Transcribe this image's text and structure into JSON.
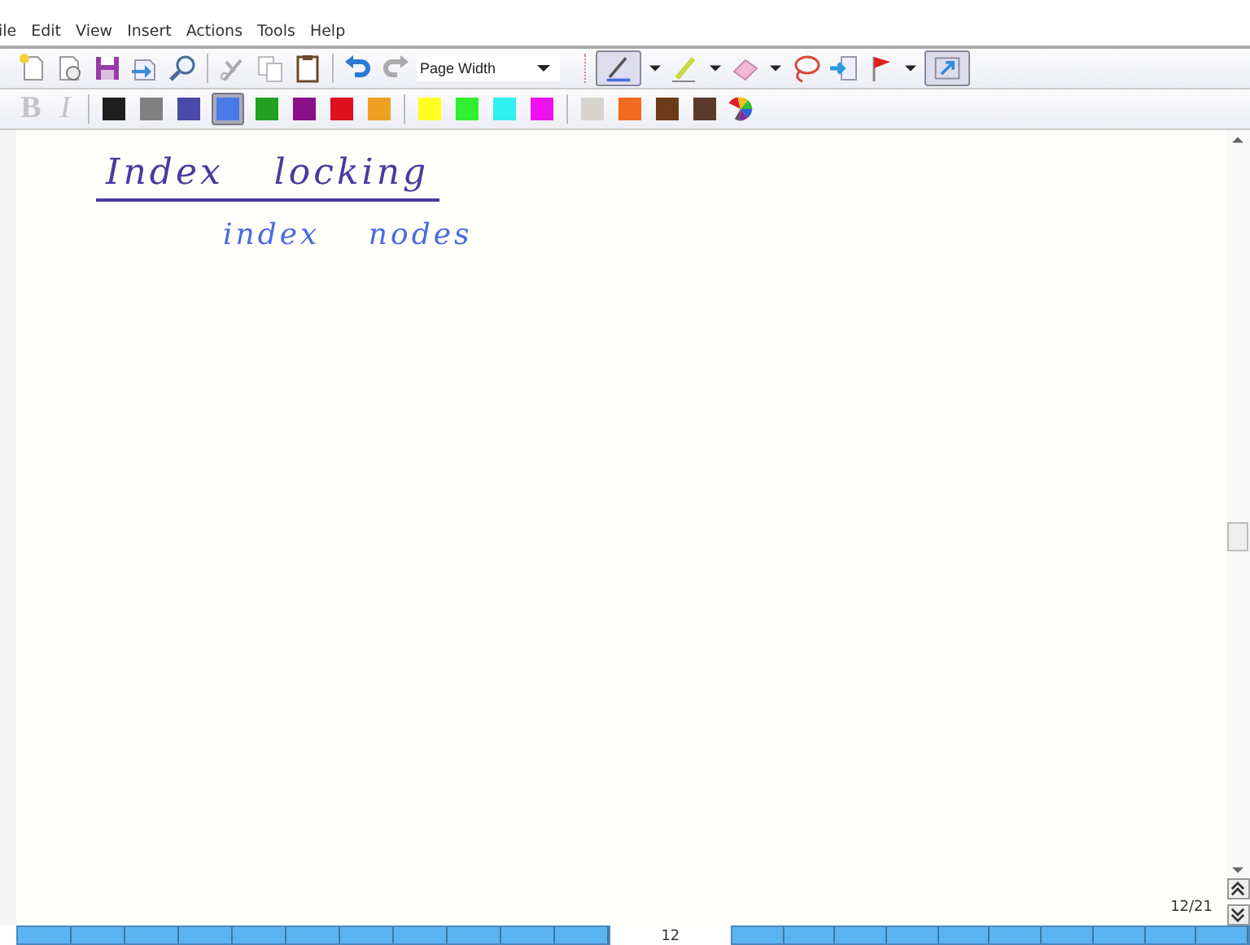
{
  "menu": [
    "ile",
    "Edit",
    "View",
    "Insert",
    "Actions",
    "Tools",
    "Help"
  ],
  "tools": [
    {
      "kind": "new-page"
    },
    {
      "kind": "template"
    },
    {
      "kind": "save"
    },
    {
      "kind": "send"
    },
    {
      "kind": "search"
    },
    {
      "kind": "sep"
    },
    {
      "kind": "cut"
    },
    {
      "kind": "copy"
    },
    {
      "kind": "paste"
    },
    {
      "kind": "sep"
    },
    {
      "kind": "undo"
    },
    {
      "kind": "redo"
    }
  ],
  "zoom": {
    "value": "Page Width"
  },
  "ink_tools": [
    {
      "kind": "pen",
      "selected": true
    },
    {
      "kind": "highlighter",
      "selected": false
    },
    {
      "kind": "eraser",
      "selected": false
    },
    {
      "kind": "lasso",
      "selected": false
    },
    {
      "kind": "insert-space",
      "selected": false
    },
    {
      "kind": "flag",
      "selected": false
    },
    {
      "kind": "view",
      "selected": true
    }
  ],
  "format": [
    {
      "label": "B",
      "kind": "bold",
      "disabled": true
    },
    {
      "label": "I",
      "kind": "italic",
      "disabled": true
    }
  ],
  "palette": [
    [
      {
        "color": "#1e1e1e",
        "selected": false
      },
      {
        "color": "#808080",
        "selected": false
      },
      {
        "color": "#4a4aa8",
        "selected": false
      },
      {
        "color": "#4a7ae8",
        "selected": true
      },
      {
        "color": "#22a022",
        "selected": false
      },
      {
        "color": "#8a108a",
        "selected": false
      },
      {
        "color": "#e01020",
        "selected": false
      },
      {
        "color": "#f0a020",
        "selected": false
      }
    ],
    [
      {
        "color": "#ffff20",
        "selected": false
      },
      {
        "color": "#30f030",
        "selected": false
      },
      {
        "color": "#30f0f0",
        "selected": false
      },
      {
        "color": "#f010f0",
        "selected": false
      }
    ],
    [
      {
        "color": "#d8d4d0",
        "selected": false
      },
      {
        "color": "#f06a20",
        "selected": false
      },
      {
        "color": "#6a3a1a",
        "selected": false
      },
      {
        "color": "#5a3a2a",
        "selected": false
      }
    ]
  ],
  "ink": [
    {
      "text": "Index locking",
      "color": "#4a3aa0",
      "underlined": true
    },
    {
      "text": "index nodes",
      "color": "#4a6ae0",
      "underlined": false
    }
  ],
  "page_counter": "12/21",
  "page_number": "12"
}
